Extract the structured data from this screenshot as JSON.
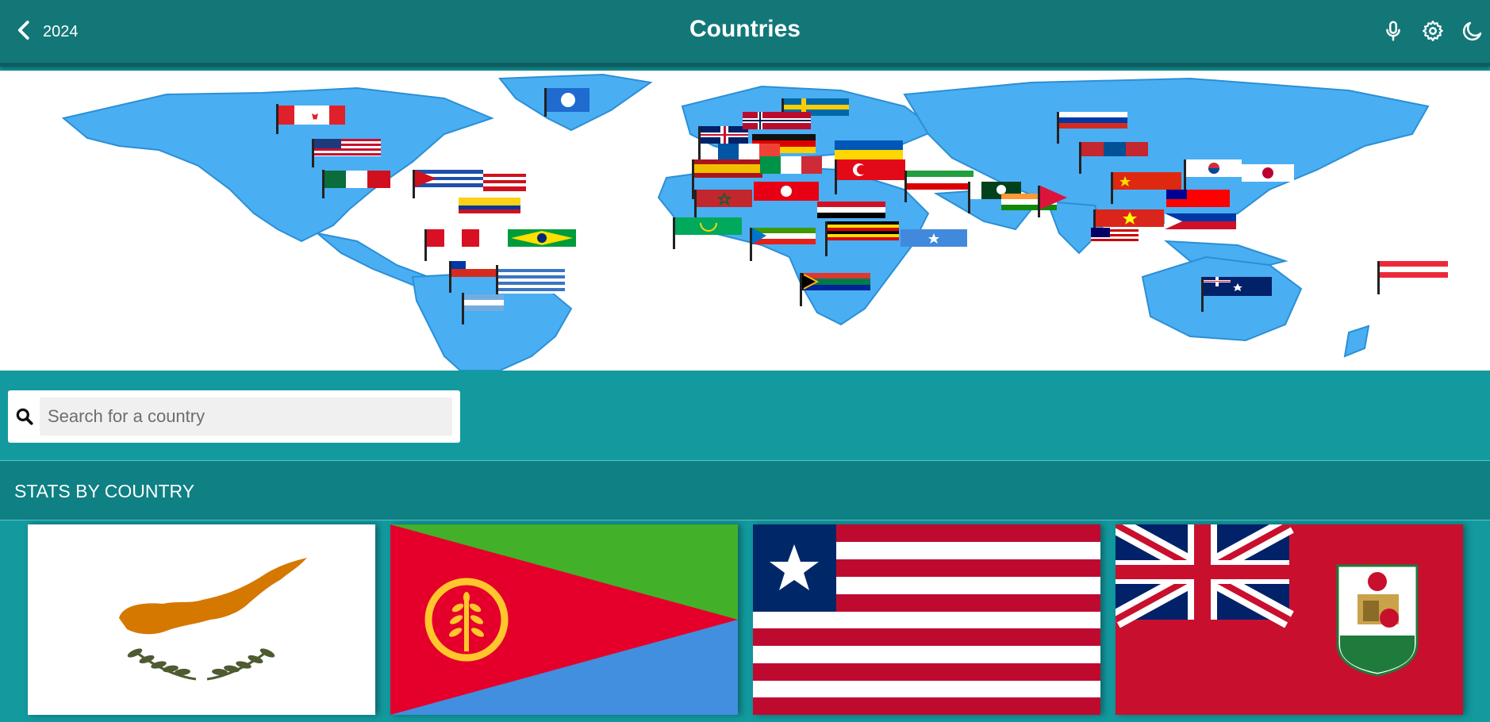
{
  "header": {
    "back_label": "2024",
    "title": "Countries",
    "icons": [
      "chevron-left-icon",
      "microphone-icon",
      "gear-icon",
      "moon-icon"
    ]
  },
  "banner": {
    "image": "world-map-with-flags",
    "colors": {
      "ocean": "#ffffff",
      "land": "#4aaef2"
    }
  },
  "search": {
    "placeholder": "Search for a country",
    "value": ""
  },
  "section": {
    "title": "STATS BY COUNTRY"
  },
  "countries": [
    {
      "flag": "cyprus-flag"
    },
    {
      "flag": "eritrea-flag"
    },
    {
      "flag": "liberia-flag"
    },
    {
      "flag": "bermuda-flag"
    }
  ],
  "theme": {
    "header_bg": "#137778",
    "page_bg": "#129a9f",
    "section_bg": "#0f8084",
    "text": "#ffffff"
  }
}
